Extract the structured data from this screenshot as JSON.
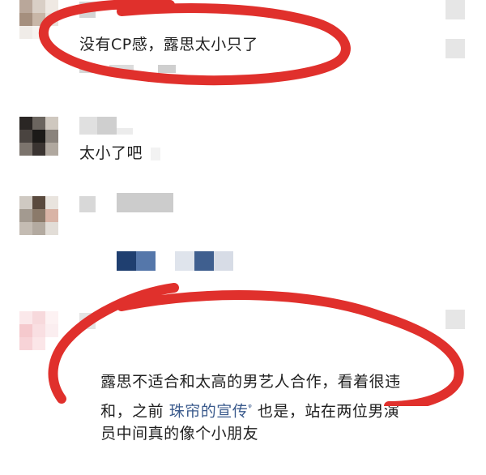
{
  "comments": [
    {
      "text": "没有CP感，露思太小只了",
      "circled": true
    },
    {
      "text": "太小了吧 "
    },
    {
      "text": ""
    },
    {
      "text_before": "露思不适合和太高的男艺人合作，看着很违",
      "line2_before": "和，之前 ",
      "link": "珠帘的宣传",
      "link_mark": "ᵠ",
      "line2_after": " 也是，站在两位男演",
      "line3": "员中间真的像个小朋友",
      "circled": true
    }
  ],
  "annotation_color": "#e0302c",
  "link_color": "#3a5a8c"
}
